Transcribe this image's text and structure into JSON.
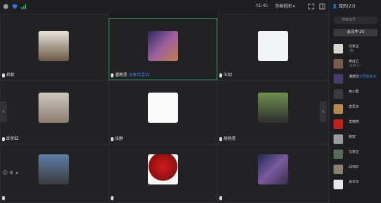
{
  "toolbar": {
    "time": "01:45",
    "view_label": "宫格视图 ▾"
  },
  "tiles": [
    {
      "name": "柳絮",
      "sub": ""
    },
    {
      "name": "潘教授",
      "sub": "分屏给会议"
    },
    {
      "name": "王如",
      "sub": ""
    },
    {
      "name": "邱伟红",
      "sub": ""
    },
    {
      "name": "张静",
      "sub": ""
    },
    {
      "name": "周艳青",
      "sub": ""
    },
    {
      "name": "",
      "sub": ""
    },
    {
      "name": "",
      "sub": ""
    },
    {
      "name": "",
      "sub": ""
    }
  ],
  "panel": {
    "title": "成员(23)",
    "search_placeholder": "搜索成员",
    "tab_label": "会议中·20",
    "members": [
      {
        "name": "向家宝",
        "sub": "(我)"
      },
      {
        "name": "黄成立",
        "sub": "(主持人)"
      },
      {
        "name": "潘教授",
        "sub": "分屏给会议"
      },
      {
        "name": "黄小群",
        "sub": ""
      },
      {
        "name": "唐思本",
        "sub": ""
      },
      {
        "name": "李楠燕",
        "sub": ""
      },
      {
        "name": "柳絮",
        "sub": ""
      },
      {
        "name": "马家正",
        "sub": ""
      },
      {
        "name": "邱伟红",
        "sub": ""
      },
      {
        "name": "冉华平",
        "sub": ""
      }
    ]
  }
}
